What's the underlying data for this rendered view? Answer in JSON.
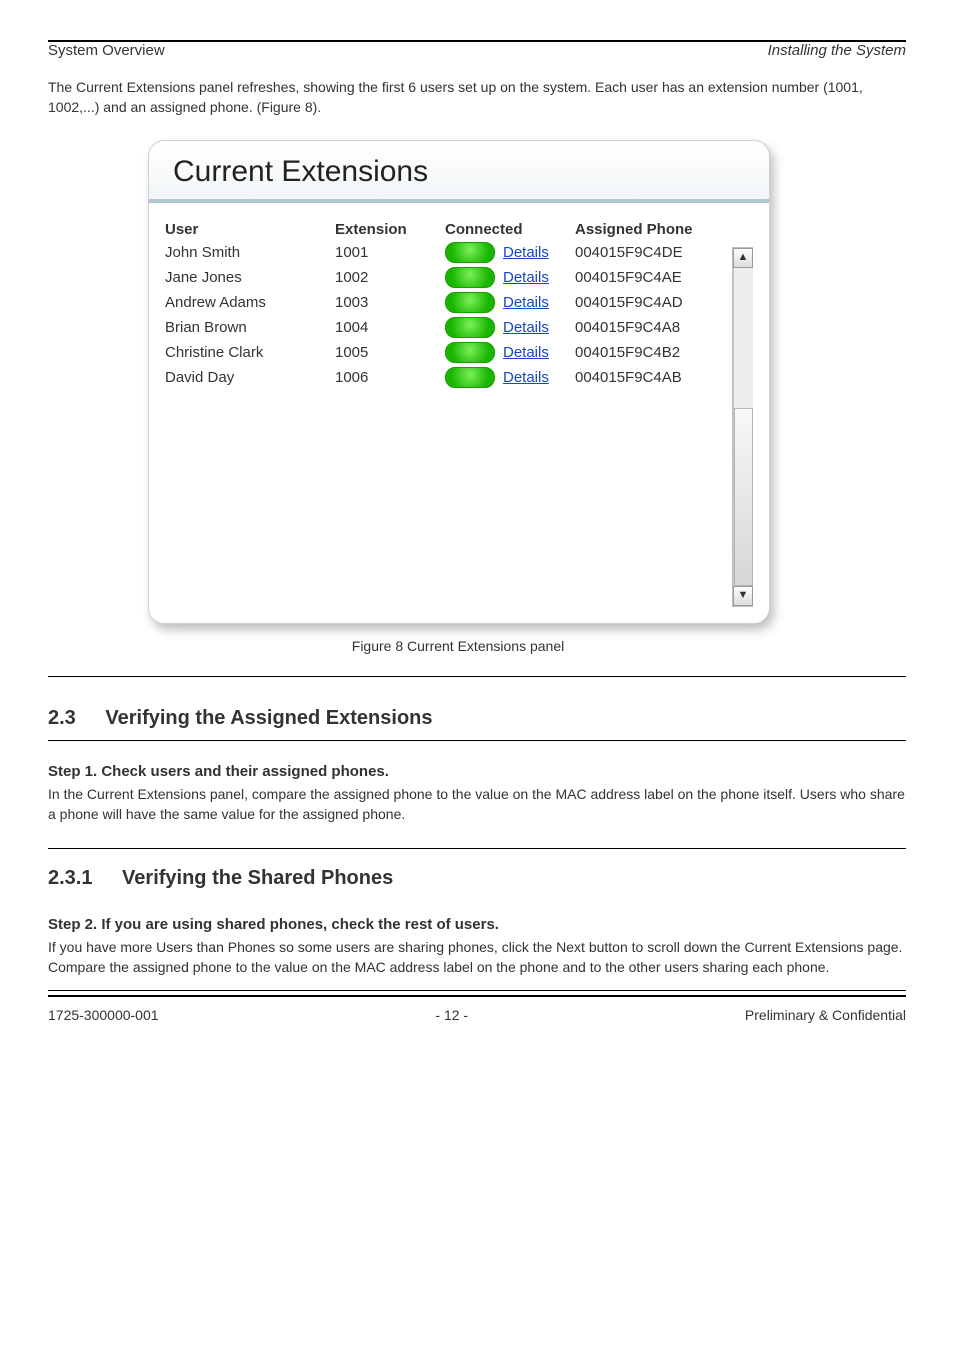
{
  "header": {
    "left": "System Overview",
    "right": "Installing the System"
  },
  "intro": {
    "para": "The Current Extensions panel refreshes, showing the first 6 users set up on the system. Each user has an extension number (1001, 1002,...) and an assigned phone. (Figure 8)."
  },
  "panel_title": "Current Extensions",
  "columns": {
    "user": "User",
    "extension": "Extension",
    "connected": "Connected",
    "assigned": "Assigned Phone"
  },
  "details_label": "Details",
  "rows": [
    {
      "user": "John Smith",
      "extension": "1001",
      "mac": "004015F9C4DE"
    },
    {
      "user": "Jane Jones",
      "extension": "1002",
      "mac": "004015F9C4AE"
    },
    {
      "user": "Andrew Adams",
      "extension": "1003",
      "mac": "004015F9C4AD"
    },
    {
      "user": "Brian Brown",
      "extension": "1004",
      "mac": "004015F9C4A8"
    },
    {
      "user": "Christine Clark",
      "extension": "1005",
      "mac": "004015F9C4B2"
    },
    {
      "user": "David Day",
      "extension": "1006",
      "mac": "004015F9C4AB"
    }
  ],
  "figure_caption": "Figure 8   Current Extensions panel",
  "section": {
    "num": "2.3",
    "title": "Verifying the Assigned Extensions"
  },
  "step1": {
    "title": "Step 1. Check users and their assigned phones.",
    "body": "In the Current Extensions panel, compare the assigned phone to the value on the MAC address label on the phone itself. Users who share a phone will have the same value for the assigned phone."
  },
  "subsection": {
    "num": "2.3.1",
    "title": "Verifying the Shared Phones"
  },
  "step2": {
    "title": "Step 2. If you are using shared phones, check the rest of users.",
    "body": "If you have more Users than Phones so some users are sharing phones, click the Next button to scroll down the Current Extensions page. Compare the assigned phone to the value on the MAC address label on the phone and to the other users sharing each phone."
  },
  "footer": {
    "left": "1725-300000-001",
    "center": "- 12 -",
    "right": "Preliminary & Confidential"
  }
}
